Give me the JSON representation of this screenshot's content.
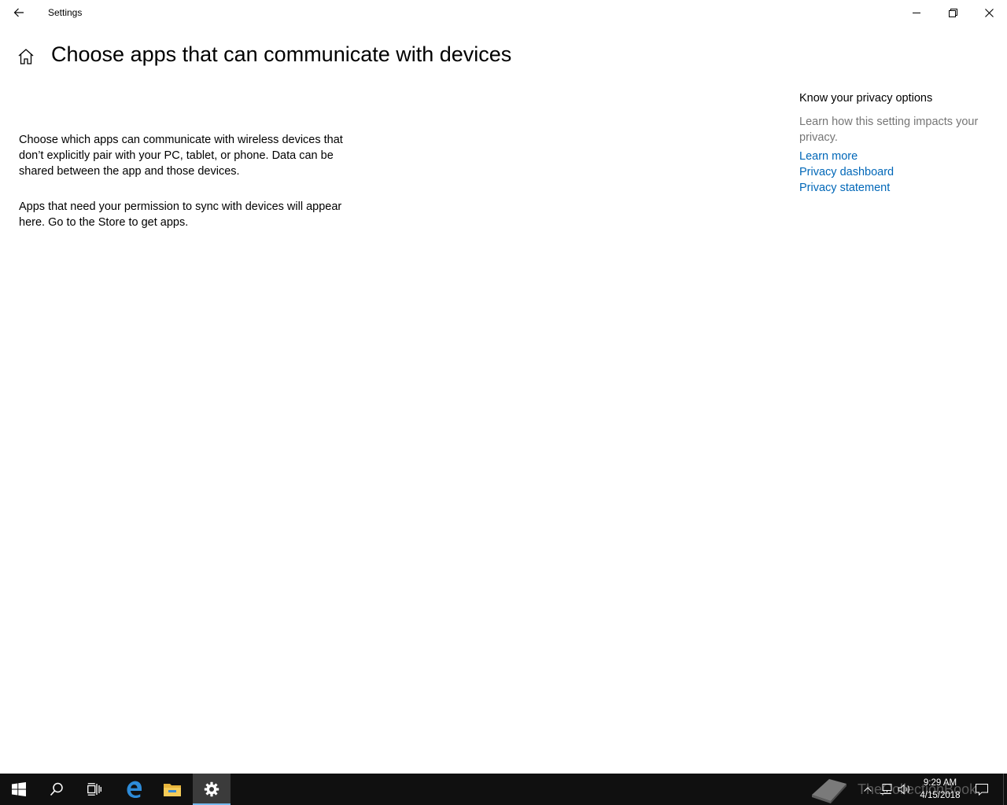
{
  "window": {
    "title": "Settings"
  },
  "header": {
    "page_title": "Choose apps that can communicate with devices"
  },
  "main": {
    "description": "Choose which apps can communicate with wireless devices that don’t explicitly pair with your PC, tablet, or phone. Data can be shared between the app and those devices.",
    "no_apps_text": "Apps that need your permission to sync with devices will appear here. Go to the Store to get apps."
  },
  "aside": {
    "title": "Know your privacy options",
    "description": "Learn how this setting impacts your privacy.",
    "links": [
      "Learn more",
      "Privacy dashboard",
      "Privacy statement"
    ]
  },
  "taskbar": {
    "time": "9:29 AM",
    "date": "4/15/2018",
    "watermark": "TheCollectionBook",
    "accent_color": "#76b9ed",
    "pinned": [
      "windows-start-icon",
      "search-icon",
      "task-view-icon",
      "edge-icon",
      "file-explorer-icon",
      "settings-gear-icon"
    ]
  },
  "colors": {
    "link": "#0067b8",
    "secondary_text": "#767676",
    "taskbar_bg": "#101010"
  }
}
